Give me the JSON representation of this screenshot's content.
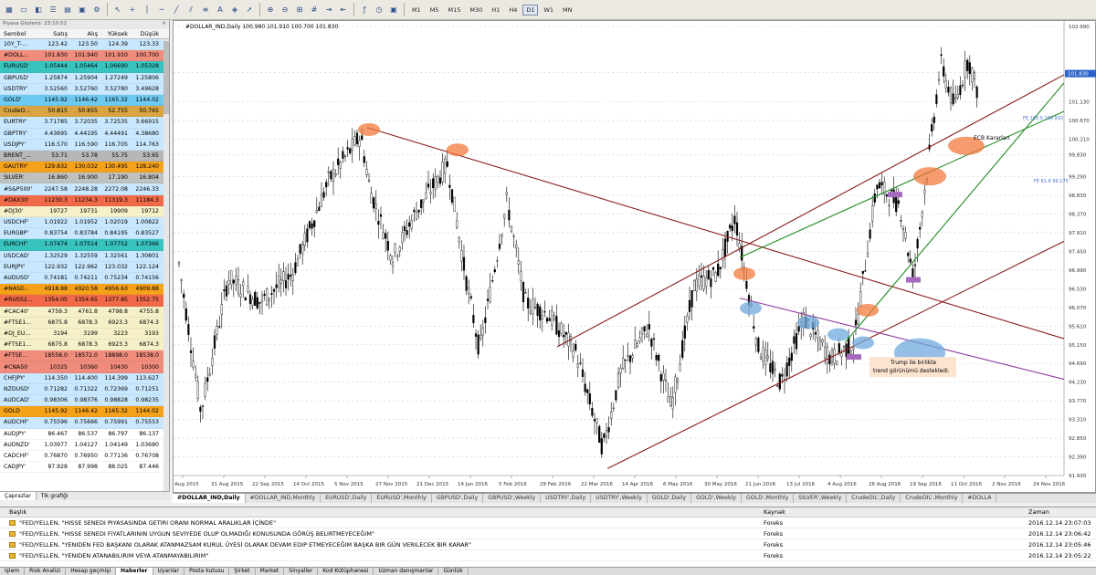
{
  "market_watch": {
    "title": "Piyasa Gözlemi: 23:10:52",
    "columns": [
      "Sembol",
      "Satış",
      "Alış",
      "Yüksek",
      "Düşük"
    ],
    "rows": [
      {
        "sym": "10Y_T-...",
        "bid": "123.42",
        "ask": "123.50",
        "high": "124.39",
        "low": "123.33",
        "bg": "#c9e8ff"
      },
      {
        "sym": "#DOLL...",
        "bid": "101.830",
        "ask": "101.940",
        "high": "101.910",
        "low": "100.700",
        "bg": "#f08c7c"
      },
      {
        "sym": "EURUSD'",
        "bid": "1.05444",
        "ask": "1.05464",
        "high": "1.06690",
        "low": "1.05328",
        "bg": "#39c3bf"
      },
      {
        "sym": "GBPUSD'",
        "bid": "1.25874",
        "ask": "1.25904",
        "high": "1.27249",
        "low": "1.25806",
        "bg": "#c9e8ff"
      },
      {
        "sym": "USDTRY'",
        "bid": "3.52560",
        "ask": "3.52760",
        "high": "3.52780",
        "low": "3.49628",
        "bg": "#c9e8ff"
      },
      {
        "sym": "GOLD'",
        "bid": "1145.92",
        "ask": "1146.42",
        "high": "1165.32",
        "low": "1144.02",
        "bg": "#6ec9f0"
      },
      {
        "sym": "CrudeO...",
        "bid": "50.815",
        "ask": "50.855",
        "high": "52.755",
        "low": "50.765",
        "bg": "#d9a441"
      },
      {
        "sym": "EURTRY'",
        "bid": "3.71785",
        "ask": "3.72035",
        "high": "3.72535",
        "low": "3.66915",
        "bg": "#c9e8ff"
      },
      {
        "sym": "GBPTRY'",
        "bid": "4.43695",
        "ask": "4.44195",
        "high": "4.44491",
        "low": "4.38680",
        "bg": "#c9e8ff"
      },
      {
        "sym": "USDJPY'",
        "bid": "116.570",
        "ask": "116.590",
        "high": "116.705",
        "low": "114.763",
        "bg": "#c9e8ff"
      },
      {
        "sym": "BRENT_...",
        "bid": "53.71",
        "ask": "53.78",
        "high": "55.75",
        "low": "53.65",
        "bg": "#b7b7b7"
      },
      {
        "sym": "GAUTRY'",
        "bid": "129.832",
        "ask": "130.032",
        "high": "130.495",
        "low": "128.240",
        "bg": "#f5a11a"
      },
      {
        "sym": "SILVER'",
        "bid": "16.860",
        "ask": "16.900",
        "high": "17.190",
        "low": "16.804",
        "bg": "#c0c0c0"
      },
      {
        "sym": "#S&P500'",
        "bid": "2247.58",
        "ask": "2248.28",
        "high": "2272.08",
        "low": "2246.33",
        "bg": "#c9e8ff"
      },
      {
        "sym": "#DAX30'",
        "bid": "11230.3",
        "ask": "11234.3",
        "high": "11319.3",
        "low": "11184.3",
        "bg": "#f06a4a"
      },
      {
        "sym": "#DJ30'",
        "bid": "19727",
        "ask": "19731",
        "high": "19909",
        "low": "19712",
        "bg": "#f5f0c8"
      },
      {
        "sym": "USDCHF'",
        "bid": "1.01922",
        "ask": "1.01952",
        "high": "1.02019",
        "low": "1.00822",
        "bg": "#c9e8ff"
      },
      {
        "sym": "EURGBP'",
        "bid": "0.83754",
        "ask": "0.83784",
        "high": "0.84195",
        "low": "0.83527",
        "bg": "#c9e8ff"
      },
      {
        "sym": "EURCHF'",
        "bid": "1.07474",
        "ask": "1.07514",
        "high": "1.07752",
        "low": "1.07366",
        "bg": "#39c3bf"
      },
      {
        "sym": "USDCAD'",
        "bid": "1.32529",
        "ask": "1.32559",
        "high": "1.32561",
        "low": "1.30801",
        "bg": "#c9e8ff"
      },
      {
        "sym": "EURJPY'",
        "bid": "122.932",
        "ask": "122.962",
        "high": "123.032",
        "low": "122.124",
        "bg": "#c9e8ff"
      },
      {
        "sym": "AUDUSD'",
        "bid": "0.74181",
        "ask": "0.74211",
        "high": "0.75234",
        "low": "0.74156",
        "bg": "#c9e8ff"
      },
      {
        "sym": "#NASD...",
        "bid": "4918.88",
        "ask": "4920.58",
        "high": "4956.63",
        "low": "4909.88",
        "bg": "#f5a11a"
      },
      {
        "sym": "#RUSS2...",
        "bid": "1354.05",
        "ask": "1354.65",
        "high": "1377.85",
        "low": "1352.75",
        "bg": "#f06a4a"
      },
      {
        "sym": "#CAC40'",
        "bid": "4759.3",
        "ask": "4761.8",
        "high": "4798.8",
        "low": "4755.8",
        "bg": "#f5f0c8"
      },
      {
        "sym": "#FTSE1...",
        "bid": "6875.8",
        "ask": "6878.3",
        "high": "6923.3",
        "low": "6874.3",
        "bg": "#f5f0c8"
      },
      {
        "sym": "#DJ_EU...",
        "bid": "3194",
        "ask": "3199",
        "high": "3223",
        "low": "3193",
        "bg": "#f5f0c8"
      },
      {
        "sym": "#FTSE1...",
        "bid": "6875.8",
        "ask": "6878.3",
        "high": "6923.3",
        "low": "6874.3",
        "bg": "#f5f0c8"
      },
      {
        "sym": "#FTSE...",
        "bid": "18558.0",
        "ask": "18572.0",
        "high": "18898.0",
        "low": "18538.0",
        "bg": "#f08c7c"
      },
      {
        "sym": "#CNA50",
        "bid": "10325",
        "ask": "10360",
        "high": "10430",
        "low": "10300",
        "bg": "#f08c7c"
      },
      {
        "sym": "CHFJPY'",
        "bid": "114.350",
        "ask": "114.400",
        "high": "114.399",
        "low": "113.627",
        "bg": "#c9e8ff"
      },
      {
        "sym": "NZDUSD'",
        "bid": "0.71282",
        "ask": "0.71322",
        "high": "0.72369",
        "low": "0.71251",
        "bg": "#c9e8ff"
      },
      {
        "sym": "AUDCAD'",
        "bid": "0.98306",
        "ask": "0.98376",
        "high": "0.98828",
        "low": "0.98235",
        "bg": "#c9e8ff"
      },
      {
        "sym": "GOLD",
        "bid": "1145.92",
        "ask": "1146.42",
        "high": "1165.32",
        "low": "1144.02",
        "bg": "#f5a11a"
      },
      {
        "sym": "AUDCHF'",
        "bid": "0.75596",
        "ask": "0.75666",
        "high": "0.75991",
        "low": "0.75553",
        "bg": "#c9e8ff"
      },
      {
        "sym": "AUDJPY'",
        "bid": "86.467",
        "ask": "86.537",
        "high": "86.797",
        "low": "86.137",
        "bg": "#ffffff"
      },
      {
        "sym": "AUDNZD'",
        "bid": "1.03977",
        "ask": "1.04127",
        "high": "1.04149",
        "low": "1.03680",
        "bg": "#ffffff"
      },
      {
        "sym": "CADCHF'",
        "bid": "0.76870",
        "ask": "0.76950",
        "high": "0.77136",
        "low": "0.76708",
        "bg": "#ffffff"
      },
      {
        "sym": "CADJPY'",
        "bid": "87.928",
        "ask": "87.998",
        "high": "88.025",
        "low": "87.446",
        "bg": "#ffffff"
      }
    ],
    "tabs": [
      "Çaprazlar",
      "Tik grafiği"
    ]
  },
  "toolbar": {
    "timeframes": [
      "M1",
      "M5",
      "M15",
      "M30",
      "H1",
      "H4",
      "D1",
      "W1",
      "MN"
    ],
    "active_timeframe": "D1",
    "icons": [
      "new-chart-icon",
      "profiles-icon",
      "market-watch-icon",
      "navigator-icon",
      "data-window-icon",
      "terminal-icon",
      "tester-icon",
      "cursor-icon",
      "crosshair-icon",
      "vertical-line-icon",
      "horizontal-line-icon",
      "trendline-icon",
      "channel-icon",
      "fibonacci-icon",
      "text-icon",
      "label-icon",
      "arrow-icon",
      "zoom-in-icon",
      "zoom-out-icon",
      "tile-icon",
      "grid-icon",
      "autoscroll-icon",
      "chart-shift-icon",
      "indicators-icon",
      "periods-icon",
      "templates-icon"
    ]
  },
  "chart": {
    "title": "#DOLLAR_IND,Daily  100.980 101.910 100.700 101.830",
    "price_labels": [
      "102.990",
      "101.850",
      "101.130",
      "100.670",
      "100.210",
      "99.830",
      "99.290",
      "98.830",
      "98.370",
      "97.910",
      "97.450",
      "96.990",
      "96.530",
      "96.070",
      "95.610",
      "95.150",
      "94.690",
      "94.230",
      "93.770",
      "93.310",
      "92.850",
      "92.390",
      "91.930"
    ],
    "badge_price": "101.830",
    "date_labels": [
      "7 Aug 2015",
      "31 Aug 2015",
      "22 Sep 2015",
      "14 Oct 2015",
      "5 Nov 2015",
      "27 Nov 2015",
      "21 Dec 2015",
      "14 Jan 2016",
      "5 Feb 2016",
      "29 Feb 2016",
      "22 Mar 2016",
      "14 Apr 2016",
      "6 May 2016",
      "30 May 2016",
      "21 Jun 2016",
      "13 Jul 2016",
      "4 Aug 2016",
      "26 Aug 2016",
      "19 Sep 2016",
      "11 Oct 2016",
      "2 Nov 2016",
      "24 Nov 2016"
    ],
    "annotations": {
      "ecb": "ECB Kararları",
      "trump_line1": "Trump ile birlikte",
      "trump_line2": "trend görünümü destekledi.",
      "fe1": "FE 100.0 100.910",
      "fe2": "FE 61.8 99.175"
    }
  },
  "chart_tabs": [
    "#DOLLAR_IND,Daily",
    "#DOLLAR_IND,Monthly",
    "EURUSD',Daily",
    "EURUSD',Monthly",
    "GBPUSD',Daily",
    "GBPUSD',Weekly",
    "USDTRY',Daily",
    "USDTRY',Weekly",
    "GOLD',Daily",
    "GOLD',Weekly",
    "GOLD',Monthly",
    "SILVER',Weekly",
    "CrudeOIL',Daily",
    "CrudeOIL',Monthly",
    "#DOLLA"
  ],
  "news": {
    "headers": [
      "Başlık",
      "Kaynak",
      "Zaman"
    ],
    "rows": [
      {
        "title": "\"FED/YELLEN, \"HISSE SENEDI PIYASASINDA GETIRI ORANI NORMAL ARALIKLAR İÇİNDE\"",
        "source": "Foreks",
        "time": "2016.12.14 23:07:03"
      },
      {
        "title": "\"FED/YELLEN, \"HISSE SENEDI FIYATLARININ UYGUN SEVIYEDE OLUP OLMADIĞI KONUSUNDA GÖRÜŞ BELIRTMEYECEĞIM\"",
        "source": "Foreks",
        "time": "2016.12.14 23:06:42"
      },
      {
        "title": "\"FED/YELLEN, \"YENIDEN FED BAŞKANI OLARAK ATANMAZSAM KURUL ÜYESİ OLARAK DEVAM EDIP ETMEYECEĞIM BAŞKA BIR GÜN VERILECEK BIR KARAR\"",
        "source": "Foreks",
        "time": "2016.12.14 23:05:46"
      },
      {
        "title": "\"FED/YELLEN, \"YENIDEN ATANABILIRIM VEYA ATANMAYABILIRIM\"",
        "source": "Foreks",
        "time": "2016.12.14 23:05:22"
      }
    ]
  },
  "bottom_tabs": [
    "İşlem",
    "Risk Analizi",
    "Hesap geçmişi",
    "Haberler",
    "Uyarılar",
    "Posta kutusu",
    "Şirket",
    "Market",
    "Sinyaller",
    "Kod Kütüphanesi",
    "Uzman danışmanlar",
    "Günlük"
  ],
  "active_bottom_tab": "Haberler",
  "colors": {
    "bullish_line": "#228b22",
    "bearish_line": "#8b1a1a",
    "channel_purple": "#8b3a9b",
    "highlight_orange": "#f27a3c",
    "highlight_blue": "#6fa8dc"
  }
}
